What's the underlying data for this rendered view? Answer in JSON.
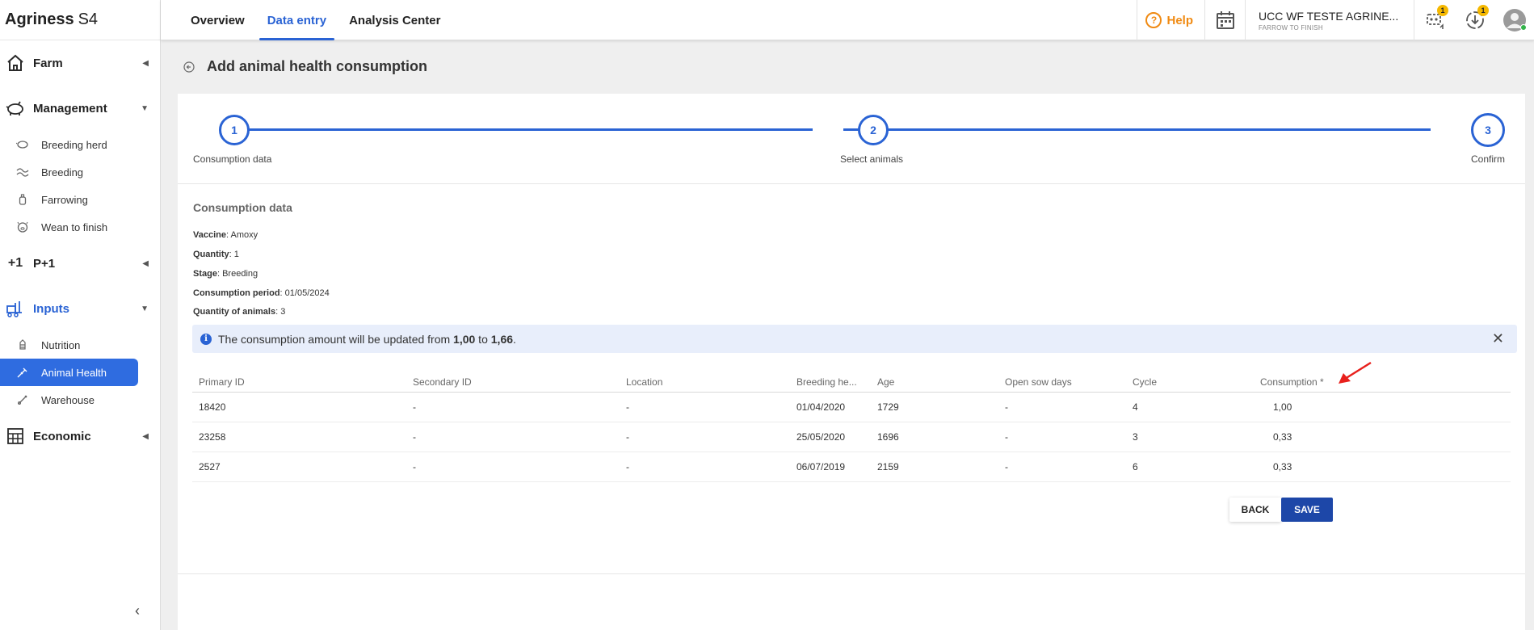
{
  "brand": {
    "name_bold": "Agriness",
    "name_light": "S4"
  },
  "tabs": [
    {
      "label": "Overview"
    },
    {
      "label": "Data entry"
    },
    {
      "label": "Analysis Center"
    }
  ],
  "topbar": {
    "help_label": "Help",
    "farm_name": "UCC WF TESTE AGRINE...",
    "farm_subtitle": "FARROW TO FINISH",
    "notifications_badge": "1",
    "downloads_badge": "1"
  },
  "sidebar": {
    "sections": {
      "farm": "Farm",
      "management": "Management",
      "p1": "P+1",
      "inputs": "Inputs",
      "economic": "Economic"
    },
    "management_items": [
      "Breeding herd",
      "Breeding",
      "Farrowing",
      "Wean to finish"
    ],
    "inputs_items": [
      "Nutrition",
      "Animal Health",
      "Warehouse"
    ],
    "p1_icon_text": "+1"
  },
  "page": {
    "title": "Add animal health consumption"
  },
  "steps": [
    {
      "number": "1",
      "label": "Consumption data"
    },
    {
      "number": "2",
      "label": "Select animals"
    },
    {
      "number": "3",
      "label": "Confirm"
    }
  ],
  "consumption": {
    "section_title": "Consumption data",
    "vaccine_label": "Vaccine",
    "vaccine_value": "Amoxy",
    "quantity_label": "Quantity",
    "quantity_value": "1",
    "stage_label": "Stage",
    "stage_value": "Breeding",
    "period_label": "Consumption period",
    "period_value": "01/05/2024",
    "animals_label": "Quantity of animals",
    "animals_value": "3"
  },
  "info": {
    "prefix": "The consumption amount will be updated from ",
    "from": "1,00",
    "middle": " to ",
    "to": "1,66",
    "suffix": "."
  },
  "table": {
    "headers": [
      "Primary ID",
      "Secondary ID",
      "Location",
      "Breeding he...",
      "Age",
      "Open sow days",
      "Cycle",
      "Consumption *"
    ],
    "rows": [
      [
        "18420",
        "-",
        "-",
        "01/04/2020",
        "1729",
        "-",
        "4",
        "1,00"
      ],
      [
        "23258",
        "-",
        "-",
        "25/05/2020",
        "1696",
        "-",
        "3",
        "0,33"
      ],
      [
        "2527",
        "-",
        "-",
        "06/07/2019",
        "2159",
        "-",
        "6",
        "0,33"
      ]
    ]
  },
  "buttons": {
    "back": "BACK",
    "save": "SAVE"
  },
  "colors": {
    "primary": "#2a63d4",
    "save_button": "#1d47a8",
    "help": "#f08a12",
    "badge": "#f5b800",
    "annotation_arrow": "#e8201c"
  }
}
